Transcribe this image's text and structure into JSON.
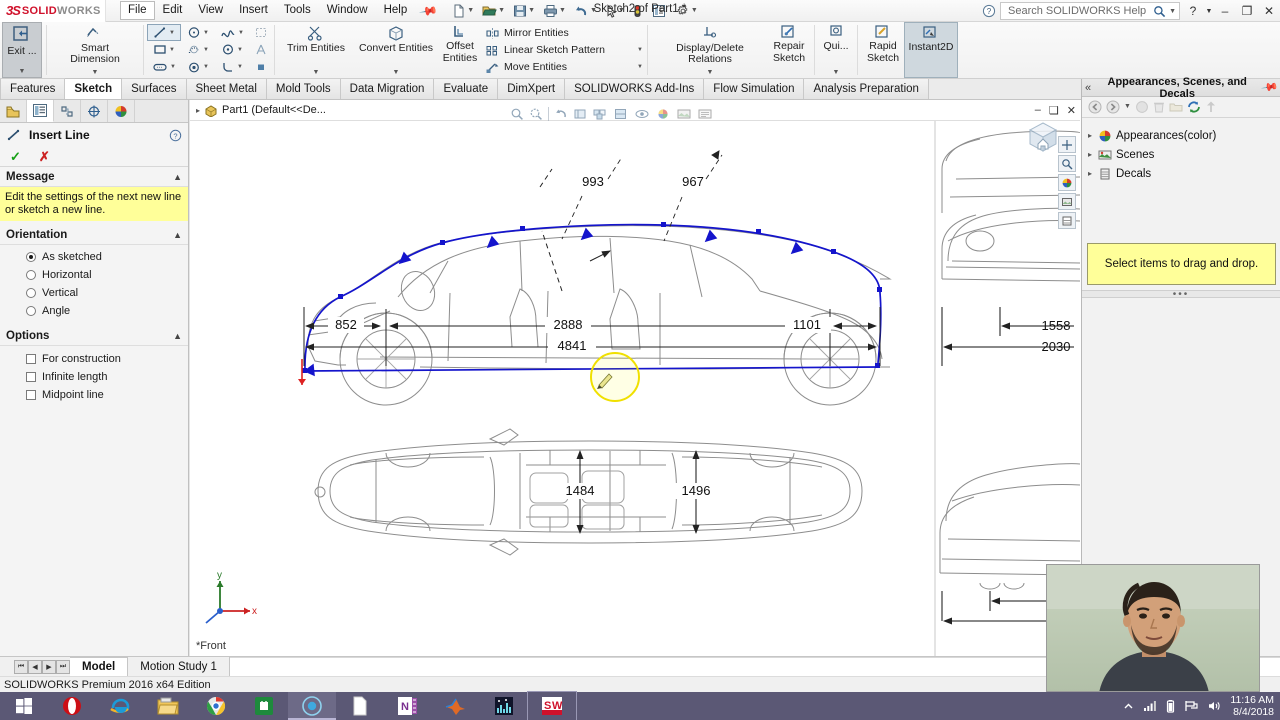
{
  "app": {
    "brand_ds": "3S",
    "brand_solid": "SOLID",
    "brand_works": "WORKS",
    "document_title": "Sketch2 of Part1 *",
    "status_text": "SOLIDWORKS Premium 2016 x64 Edition"
  },
  "menu": {
    "items": [
      "File",
      "Edit",
      "View",
      "Insert",
      "Tools",
      "Window",
      "Help"
    ],
    "active": "File",
    "pin_icon": "pin-icon"
  },
  "quick_access": {
    "buttons": [
      {
        "name": "new-document",
        "icon": "document-icon"
      },
      {
        "name": "open-document",
        "icon": "folder-open-icon"
      },
      {
        "name": "save-document",
        "icon": "save-icon"
      },
      {
        "name": "print-document",
        "icon": "printer-icon"
      },
      {
        "name": "undo",
        "icon": "undo-arrow-icon"
      },
      {
        "name": "select",
        "icon": "cursor-arrow-icon"
      },
      {
        "name": "rebuild",
        "icon": "traffic-light-icon"
      },
      {
        "name": "file-properties",
        "icon": "properties-icon"
      },
      {
        "name": "options",
        "icon": "gear-icon"
      }
    ]
  },
  "titlebar_right": {
    "help_icon": "help-circle-icon",
    "search_placeholder": "Search SOLIDWORKS Help",
    "search_icon": "magnifier-icon",
    "help_menu": "?",
    "minimize": "–",
    "restore": "❐",
    "close": "✕"
  },
  "ribbon": {
    "exit": {
      "label": "Exit ...",
      "icon": "exit-sketch-icon",
      "selected": true
    },
    "smart_dimension": {
      "label": "Smart Dimension",
      "icon": "smart-dimension-icon"
    },
    "sketch_tools_grid": [
      {
        "name": "line-tool",
        "icon": "line-icon",
        "selected": true,
        "caret": true
      },
      {
        "name": "circle-tool",
        "icon": "circle-icon",
        "caret": true
      },
      {
        "name": "spline-tool",
        "icon": "spline-icon",
        "caret": true
      },
      {
        "name": "surface-tool",
        "icon": "surface-icon",
        "caret": false
      },
      {
        "name": "rectangle-tool",
        "icon": "rectangle-icon",
        "caret": true
      },
      {
        "name": "arc-slot-tool",
        "icon": "arc-slot-icon",
        "caret": true
      },
      {
        "name": "perimeter-circle-tool",
        "icon": "perimeter-circle-icon",
        "caret": true
      },
      {
        "name": "text-tool",
        "icon": "text-a-icon",
        "caret": false
      },
      {
        "name": "slot-tool",
        "icon": "slot-icon",
        "caret": true
      },
      {
        "name": "point-tool",
        "icon": "point-icon",
        "caret": true
      },
      {
        "name": "fillet-tool",
        "icon": "sketch-fillet-icon",
        "caret": true
      },
      {
        "name": "plane-tool",
        "icon": "sketch-plane-icon",
        "caret": false
      }
    ],
    "trim_entities": {
      "label": "Trim Entities",
      "icon": "trim-entities-icon"
    },
    "convert_entities": {
      "label": "Convert Entities",
      "icon": "convert-entities-icon"
    },
    "offset_entities": {
      "label_line1": "Offset",
      "label_line2": "Entities",
      "icon": "offset-entities-icon"
    },
    "pattern_list": [
      {
        "name": "mirror-entities",
        "label": "Mirror Entities",
        "icon": "mirror-entities-icon",
        "caret": false
      },
      {
        "name": "linear-sketch-pattern",
        "label": "Linear Sketch Pattern",
        "icon": "linear-pattern-icon",
        "caret": true
      },
      {
        "name": "move-entities",
        "label": "Move Entities",
        "icon": "move-entities-icon",
        "caret": true
      }
    ],
    "display_delete_relations": {
      "label": "Display/Delete Relations",
      "icon": "relations-icon"
    },
    "repair_sketch": {
      "label_line1": "Repair",
      "label_line2": "Sketch",
      "icon": "repair-sketch-icon"
    },
    "quick_snaps": {
      "label": "Qui...",
      "icon": "quick-snaps-icon"
    },
    "rapid_sketch": {
      "label_line1": "Rapid",
      "label_line2": "Sketch",
      "icon": "rapid-sketch-icon"
    },
    "instant2d": {
      "label": "Instant2D",
      "icon": "instant2d-icon",
      "selected": true
    }
  },
  "command_tabs": {
    "items": [
      "Features",
      "Sketch",
      "Surfaces",
      "Sheet Metal",
      "Mold Tools",
      "Data Migration",
      "Evaluate",
      "DimXpert",
      "SOLIDWORKS Add-Ins",
      "Flow Simulation",
      "Analysis Preparation"
    ],
    "active": "Sketch"
  },
  "property_manager": {
    "tabs": [
      {
        "name": "feature-manager-tab",
        "icon": "feature-tree-icon",
        "active": false
      },
      {
        "name": "property-manager-tab",
        "icon": "property-manager-icon",
        "active": true
      },
      {
        "name": "configuration-manager-tab",
        "icon": "configuration-icon",
        "active": false
      },
      {
        "name": "dimxpert-manager-tab",
        "icon": "dimxpert-icon",
        "active": false
      },
      {
        "name": "display-manager-tab",
        "icon": "display-manager-icon",
        "active": false
      }
    ],
    "title": "Insert Line",
    "title_icon": "line-icon",
    "help_icon": "help-circle-icon",
    "accept_icon": "checkmark-icon",
    "cancel_icon": "x-mark-icon",
    "sections": {
      "message": {
        "header": "Message",
        "text": "Edit the settings of the next new line or sketch a new line."
      },
      "orientation": {
        "header": "Orientation",
        "options": [
          {
            "label": "As sketched",
            "selected": true
          },
          {
            "label": "Horizontal",
            "selected": false
          },
          {
            "label": "Vertical",
            "selected": false
          },
          {
            "label": "Angle",
            "selected": false
          }
        ]
      },
      "options": {
        "header": "Options",
        "checkboxes": [
          {
            "label": "For construction",
            "checked": false
          },
          {
            "label": "Infinite length",
            "checked": false
          },
          {
            "label": "Midpoint line",
            "checked": false
          }
        ]
      }
    }
  },
  "graphics": {
    "tree_label": "Part1  (Default<<De...",
    "tree_icon": "part-icon",
    "window_buttons": [
      "–",
      "❑",
      "✕"
    ],
    "view_label": "*Front",
    "origin_label_x": "x",
    "origin_label_y": "y"
  },
  "drawing": {
    "front_view_dims": {
      "top_labels": [
        "993",
        "967"
      ],
      "chain": [
        "852",
        "2888",
        "1101"
      ],
      "overall": "4841"
    },
    "top_view_dims": [
      "1484",
      "1496"
    ],
    "right_view_dims": [
      "1558",
      "2030"
    ]
  },
  "task_pane": {
    "collapse_icon": "double-chevron-left-icon",
    "title": "Appearances, Scenes, and Decals",
    "pin_icon": "pin-icon",
    "toolbar": [
      {
        "name": "back-button",
        "icon": "back-arrow-icon"
      },
      {
        "name": "forward-button",
        "icon": "forward-arrow-icon"
      },
      {
        "name": "history-dropdown",
        "icon": "chevron-down-icon"
      },
      {
        "name": "appearance-button",
        "icon": "appearance-sphere-icon"
      },
      {
        "name": "delete-button",
        "icon": "trash-icon"
      },
      {
        "name": "new-folder-button",
        "icon": "new-folder-icon"
      },
      {
        "name": "refresh-button",
        "icon": "refresh-icon"
      },
      {
        "name": "up-one-level-button",
        "icon": "up-arrow-icon"
      }
    ],
    "tree": [
      {
        "label": "Appearances(color)",
        "icon": "appearance-sphere-icon"
      },
      {
        "label": "Scenes",
        "icon": "scene-icon"
      },
      {
        "label": "Decals",
        "icon": "decal-icon"
      }
    ],
    "drop_hint": "Select items to drag and drop.",
    "resize_dots": "•••"
  },
  "bottom_tabs": {
    "nav": [
      "⏮",
      "◀",
      "▶",
      "⏭"
    ],
    "tabs": [
      {
        "label": "Model",
        "active": true
      },
      {
        "label": "Motion Study 1",
        "active": false
      }
    ]
  },
  "taskbar": {
    "items": [
      {
        "name": "start-button",
        "icon": "windows-logo-icon"
      },
      {
        "name": "opera-button",
        "icon": "opera-icon"
      },
      {
        "name": "internet-explorer-button",
        "icon": "internet-explorer-icon"
      },
      {
        "name": "file-explorer-button",
        "icon": "file-explorer-icon"
      },
      {
        "name": "chrome-button",
        "icon": "chrome-icon"
      },
      {
        "name": "store-button",
        "icon": "microsoft-store-icon"
      },
      {
        "name": "recorder-button",
        "icon": "recorder-circle-icon"
      },
      {
        "name": "document-button",
        "icon": "white-document-icon"
      },
      {
        "name": "onenote-button",
        "icon": "onenote-icon"
      },
      {
        "name": "matlab-button",
        "icon": "matlab-icon"
      },
      {
        "name": "analyzer-button",
        "icon": "spectrum-analyzer-icon"
      },
      {
        "name": "solidworks-button",
        "icon": "solidworks-taskbar-icon"
      }
    ],
    "tray": [
      {
        "name": "show-hidden-icons",
        "icon": "chevron-up-icon"
      },
      {
        "name": "network-icon",
        "icon": "signal-bars-icon"
      },
      {
        "name": "battery-icon",
        "icon": "battery-icon"
      },
      {
        "name": "action-center-icon",
        "icon": "flag-icon"
      },
      {
        "name": "volume-icon",
        "icon": "speaker-icon"
      }
    ],
    "clock_time": "11:16 AM",
    "clock_date": "8/4/2018"
  },
  "colors": {
    "brand_red": "#d0112b",
    "highlight_yellow": "#ffff99",
    "sketch_blue": "#0000cc",
    "taskbar": "#5b5875",
    "selection": "#cfd8de"
  }
}
